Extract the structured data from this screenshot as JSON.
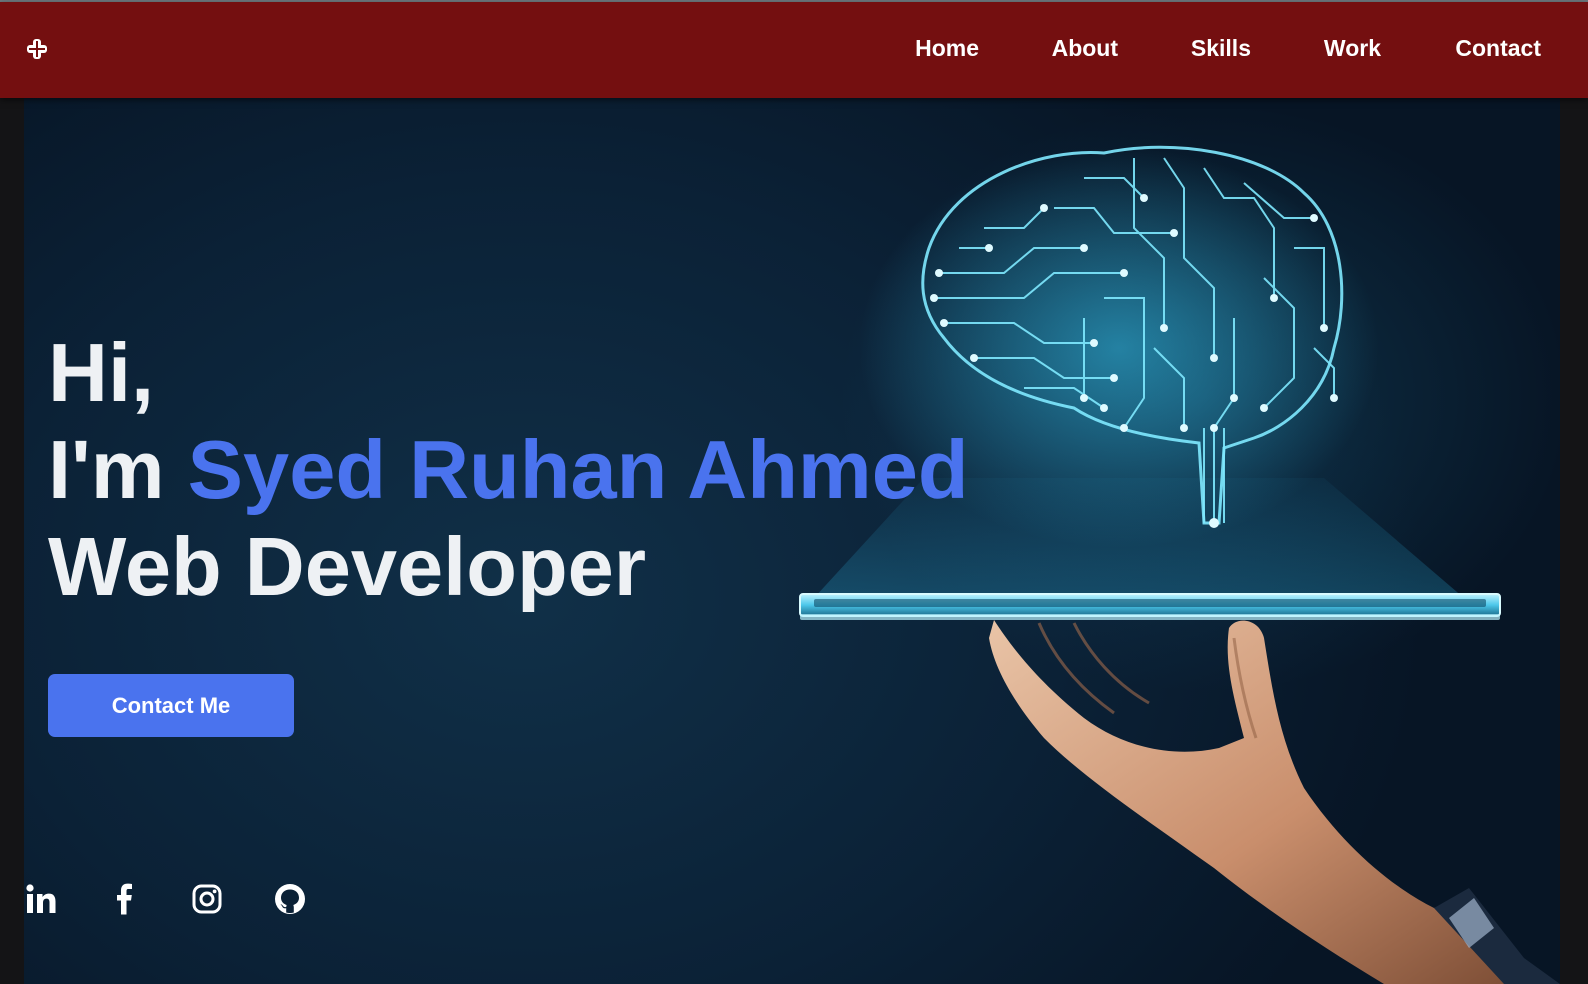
{
  "nav": {
    "logo_icon": "logo-cross-icon",
    "links": [
      "Home",
      "About",
      "Skills",
      "Work",
      "Contact"
    ]
  },
  "hero": {
    "line1": "Hi,",
    "line2_prefix": "I'm ",
    "name": "Syed Ruhan Ahmed",
    "line3": "Web Developer",
    "cta_label": "Contact Me",
    "image": "hand-holding-tablet-with-circuit-brain"
  },
  "social": [
    "linkedin-icon",
    "facebook-icon",
    "instagram-icon",
    "github-icon"
  ],
  "colors": {
    "navbar": "#740f10",
    "accent": "#4a73ee",
    "background": "#0b2136",
    "text": "#eef1f4"
  }
}
